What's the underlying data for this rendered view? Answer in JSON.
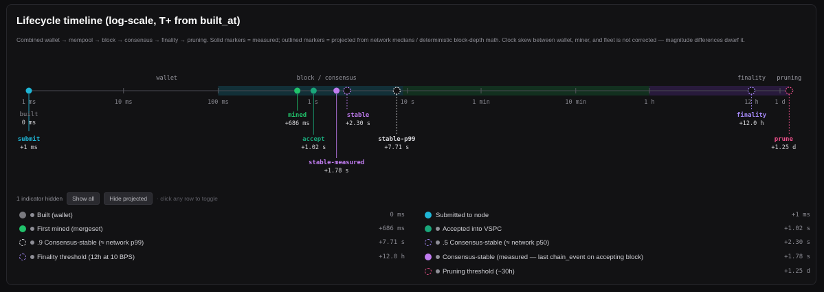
{
  "title": "Lifecycle timeline (log-scale, T+ from built_at)",
  "subtitle": "Combined wallet → mempool → block → consensus → finality → pruning. Solid markers = measured; outlined markers = projected from network medians / deterministic block-depth math. Clock skew between wallet, miner, and fleet is not corrected — magnitude differences dwarf it.",
  "colors": {
    "built": "#7a7a80",
    "submit": "#1fb6d6",
    "mined": "#21c26b",
    "accept": "#1aa67a",
    "stable": "#c07cf0",
    "finality": "#a78bfa",
    "prune": "#f0508c",
    "axis": "#555"
  },
  "phases": [
    {
      "label": "wallet"
    },
    {
      "label": "block / consensus"
    },
    {
      "label": "finality"
    },
    {
      "label": "pruning"
    }
  ],
  "ticks": [
    {
      "label": "1 ms",
      "sec": 0.001
    },
    {
      "label": "10 ms",
      "sec": 0.01
    },
    {
      "label": "100 ms",
      "sec": 0.1
    },
    {
      "label": "1 s",
      "sec": 1
    },
    {
      "label": "10 s",
      "sec": 10
    },
    {
      "label": "1 min",
      "sec": 60
    },
    {
      "label": "10 min",
      "sec": 600
    },
    {
      "label": "1 h",
      "sec": 3600
    },
    {
      "label": "12 h",
      "sec": 43200
    },
    {
      "label": "1 d",
      "sec": 86400
    }
  ],
  "events": [
    {
      "id": "built",
      "name": "built",
      "time": "0 ms",
      "sec": 0.001,
      "measured": true,
      "color": "#7a7a80"
    },
    {
      "id": "submit",
      "name": "submit",
      "time": "+1 ms",
      "sec": 0.001,
      "measured": true,
      "color": "#1fb6d6"
    },
    {
      "id": "mined",
      "name": "mined",
      "time": "+686 ms",
      "sec": 0.686,
      "measured": true,
      "color": "#21c26b"
    },
    {
      "id": "accept",
      "name": "accept",
      "time": "+1.02 s",
      "sec": 1.02,
      "measured": true,
      "color": "#1aa67a"
    },
    {
      "id": "stable-measured",
      "name": "stable-measured",
      "time": "+1.78 s",
      "sec": 1.78,
      "measured": true,
      "color": "#c07cf0"
    },
    {
      "id": "stable",
      "name": "stable",
      "time": "+2.30 s",
      "sec": 2.3,
      "measured": false,
      "color": "#c07cf0"
    },
    {
      "id": "stable-p99",
      "name": "stable-p99",
      "time": "+7.71 s",
      "sec": 7.71,
      "measured": false,
      "color": "#d8d8dc"
    },
    {
      "id": "finality",
      "name": "finality",
      "time": "+12.0 h",
      "sec": 43200,
      "measured": false,
      "color": "#a78bfa"
    },
    {
      "id": "prune",
      "name": "prune",
      "time": "+1.25 d",
      "sec": 108000,
      "measured": false,
      "color": "#f0508c"
    }
  ],
  "controls": {
    "hidden_text": "1 indicator hidden",
    "show_all": "Show all",
    "hide_projected": "Hide projected",
    "hint": "· click any row to toggle"
  },
  "legend": {
    "left": [
      {
        "label": "Built (wallet)",
        "value": "0 ms",
        "color": "#7a7a80",
        "measured": true
      },
      {
        "label": "First mined (mergeset)",
        "value": "+686 ms",
        "color": "#21c26b",
        "measured": true
      },
      {
        "label": ".9 Consensus-stable (≈ network p99)",
        "value": "+7.71 s",
        "color": "#d8d8dc",
        "measured": false
      },
      {
        "label": "Finality threshold (12h at 10 BPS)",
        "value": "+12.0 h",
        "color": "#a78bfa",
        "measured": false
      }
    ],
    "right": [
      {
        "label": "Submitted to node",
        "value": "+1 ms",
        "color": "#1fb6d6",
        "measured": true
      },
      {
        "label": "Accepted into VSPC",
        "value": "+1.02 s",
        "color": "#1aa67a",
        "measured": true
      },
      {
        "label": ".5 Consensus-stable (≈ network p50)",
        "value": "+2.30 s",
        "color": "#a78bfa",
        "measured": false
      },
      {
        "label": "Consensus-stable (measured — last chain_event on accepting block)",
        "value": "+1.78 s",
        "color": "#c07cf0",
        "measured": true
      },
      {
        "label": "Pruning threshold (~30h)",
        "value": "+1.25 d",
        "color": "#f0508c",
        "measured": false
      }
    ]
  }
}
